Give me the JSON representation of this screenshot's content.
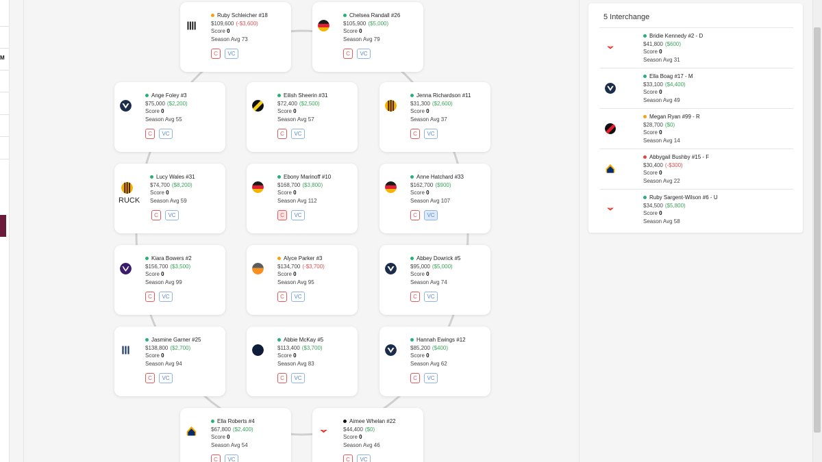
{
  "left_strip": {
    "tag": "M"
  },
  "field": {
    "players": [
      {
        "name": "Ruby Schleicher #18",
        "status": "orange",
        "price": "$109,600",
        "change": "(-$3,600)",
        "change_sign": "neg",
        "score_label": "Score",
        "score": "0",
        "season_avg": "Season Avg 73",
        "logo": "collingwood-logo",
        "c_label": "C",
        "vc_label": "VC",
        "c_active": false,
        "vc_active": false
      },
      {
        "name": "Chelsea Randall #26",
        "status": "green",
        "price": "$105,900",
        "change": "($5,000)",
        "change_sign": "pos",
        "score_label": "Score",
        "score": "0",
        "season_avg": "Season Avg 79",
        "logo": "adelaide-logo",
        "c_label": "C",
        "vc_label": "VC",
        "c_active": false,
        "vc_active": false
      },
      {
        "name": "Ange Foley #3",
        "status": "green",
        "price": "$75,000",
        "change": "($2,200)",
        "change_sign": "pos",
        "score_label": "Score",
        "score": "0",
        "season_avg": "Season Avg 55",
        "logo": "north-melbourne-logo",
        "c_label": "C",
        "vc_label": "VC",
        "c_active": false,
        "vc_active": false
      },
      {
        "name": "Eilish Sheerin #31",
        "status": "green",
        "price": "$72,400",
        "change": "($2,500)",
        "change_sign": "pos",
        "score_label": "Score",
        "score": "0",
        "season_avg": "Season Avg 57",
        "logo": "richmond-logo",
        "c_label": "C",
        "vc_label": "VC",
        "c_active": false,
        "vc_active": false
      },
      {
        "name": "Jenna Richardson #11",
        "status": "green",
        "price": "$31,300",
        "change": "($2,600)",
        "change_sign": "pos",
        "score_label": "Score",
        "score": "0",
        "season_avg": "Season Avg 37",
        "logo": "hawthorn-logo",
        "c_label": "C",
        "vc_label": "VC",
        "c_active": false,
        "vc_active": false
      },
      {
        "name": "Lucy Wales #31",
        "status": "green",
        "price": "$74,700",
        "change": "($8,200)",
        "change_sign": "pos",
        "score_label": "Score",
        "score": "0",
        "season_avg": "Season Avg 59",
        "logo": "hawthorn-logo",
        "pos_label": "RUCK",
        "c_label": "C",
        "vc_label": "VC",
        "c_active": false,
        "vc_active": false
      },
      {
        "name": "Ebony Marinoff #10",
        "status": "green",
        "price": "$168,700",
        "change": "($3,800)",
        "change_sign": "pos",
        "score_label": "Score",
        "score": "0",
        "season_avg": "Season Avg 112",
        "logo": "adelaide-logo",
        "c_label": "C",
        "vc_label": "VC",
        "c_active": true,
        "vc_active": false
      },
      {
        "name": "Anne Hatchard #33",
        "status": "green",
        "price": "$162,700",
        "change": "($900)",
        "change_sign": "pos",
        "score_label": "Score",
        "score": "0",
        "season_avg": "Season Avg 107",
        "logo": "adelaide-logo",
        "c_label": "C",
        "vc_label": "VC",
        "c_active": false,
        "vc_active": true
      },
      {
        "name": "Kiara Bowers #2",
        "status": "green",
        "price": "$156,700",
        "change": "($3,500)",
        "change_sign": "pos",
        "score_label": "Score",
        "score": "0",
        "season_avg": "Season Avg 99",
        "logo": "fremantle-logo",
        "c_label": "C",
        "vc_label": "VC",
        "c_active": false,
        "vc_active": false
      },
      {
        "name": "Alyce Parker #3",
        "status": "orange",
        "price": "$134,700",
        "change": "(-$3,700)",
        "change_sign": "neg",
        "score_label": "Score",
        "score": "0",
        "season_avg": "Season Avg 95",
        "logo": "gws-logo",
        "c_label": "C",
        "vc_label": "VC",
        "c_active": false,
        "vc_active": false
      },
      {
        "name": "Abbey Dowrick #5",
        "status": "green",
        "price": "$95,000",
        "change": "($5,000)",
        "change_sign": "pos",
        "score_label": "Score",
        "score": "0",
        "season_avg": "Season Avg 74",
        "logo": "north-melbourne-logo",
        "c_label": "C",
        "vc_label": "VC",
        "c_active": false,
        "vc_active": false
      },
      {
        "name": "Jasmine Garner #25",
        "status": "green",
        "price": "$138,800",
        "change": "($2,700)",
        "change_sign": "pos",
        "score_label": "Score",
        "score": "0",
        "season_avg": "Season Avg 94",
        "logo": "geelong-logo",
        "c_label": "C",
        "vc_label": "VC",
        "c_active": false,
        "vc_active": false
      },
      {
        "name": "Abbie McKay #5",
        "status": "green",
        "price": "$113,400",
        "change": "($3,700)",
        "change_sign": "pos",
        "score_label": "Score",
        "score": "0",
        "season_avg": "Season Avg 83",
        "logo": "carlton-logo",
        "c_label": "C",
        "vc_label": "VC",
        "c_active": false,
        "vc_active": false
      },
      {
        "name": "Hannah Ewings #12",
        "status": "green",
        "price": "$85,200",
        "change": "($400)",
        "change_sign": "pos",
        "score_label": "Score",
        "score": "0",
        "season_avg": "Season Avg 62",
        "logo": "north-melbourne-logo",
        "c_label": "C",
        "vc_label": "VC",
        "c_active": false,
        "vc_active": false
      },
      {
        "name": "Ella Roberts #4",
        "status": "green",
        "price": "$67,800",
        "change": "($2,400)",
        "change_sign": "pos",
        "score_label": "Score",
        "score": "0",
        "season_avg": "Season Avg 54",
        "logo": "west-coast-logo",
        "c_label": "C",
        "vc_label": "VC",
        "c_active": false,
        "vc_active": false
      },
      {
        "name": "Aimee Whelan #22",
        "status": "black",
        "price": "$44,400",
        "change": "($0)",
        "change_sign": "pos",
        "score_label": "Score",
        "score": "0",
        "season_avg": "Season Avg 46",
        "logo": "sydney-logo",
        "c_label": "C",
        "vc_label": "VC",
        "c_active": false,
        "vc_active": false
      }
    ]
  },
  "interchange": {
    "title": "5 Interchange",
    "players": [
      {
        "name": "Bridie Kennedy #2 - D",
        "status": "green",
        "price": "$41,800",
        "change": "($600)",
        "change_sign": "pos",
        "score_label": "Score",
        "score": "0",
        "season_avg": "Season Avg 31",
        "logo": "sydney-logo"
      },
      {
        "name": "Ella Boag #17 - M",
        "status": "green",
        "price": "$33,100",
        "change": "($4,400)",
        "change_sign": "pos",
        "score_label": "Score",
        "score": "0",
        "season_avg": "Season Avg 49",
        "logo": "north-melbourne-logo"
      },
      {
        "name": "Megan Ryan #99 - R",
        "status": "orange",
        "price": "$28,700",
        "change": "($0)",
        "change_sign": "pos",
        "score_label": "Score",
        "score": "0",
        "season_avg": "Season Avg 14",
        "logo": "essendon-logo"
      },
      {
        "name": "Abbygail Bushby #15 - F",
        "status": "red",
        "price": "$30,400",
        "change": "(-$300)",
        "change_sign": "neg",
        "score_label": "Score",
        "score": "0",
        "season_avg": "Season Avg 22",
        "logo": "west-coast-logo"
      },
      {
        "name": "Ruby Sargent-Wilson #6 - U",
        "status": "green",
        "price": "$34,500",
        "change": "($5,800)",
        "change_sign": "pos",
        "score_label": "Score",
        "score": "0",
        "season_avg": "Season Avg 58",
        "logo": "sydney-logo"
      }
    ]
  }
}
